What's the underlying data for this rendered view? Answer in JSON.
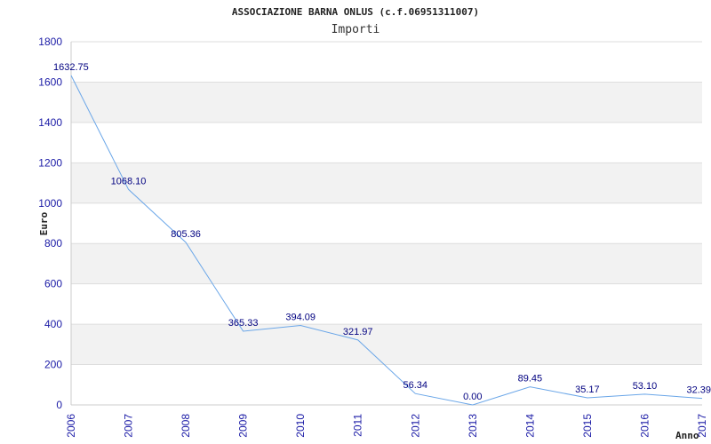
{
  "chart_data": {
    "type": "line",
    "title": "ASSOCIAZIONE BARNA ONLUS (c.f.06951311007)",
    "subtitle": "Importi",
    "xlabel": "Anno",
    "ylabel": "Euro",
    "ylim": [
      0,
      1800
    ],
    "yticks": [
      0,
      200,
      400,
      600,
      800,
      1000,
      1200,
      1400,
      1600,
      1800
    ],
    "categories": [
      "2006",
      "2007",
      "2008",
      "2009",
      "2010",
      "2011",
      "2012",
      "2013",
      "2014",
      "2015",
      "2016",
      "2017"
    ],
    "series": [
      {
        "values": [
          1632.75,
          1068.1,
          805.36,
          365.33,
          394.09,
          321.97,
          56.34,
          0.0,
          89.45,
          35.17,
          53.1,
          32.39
        ],
        "labels": [
          "1632.75",
          "1068.10",
          "805.36",
          "365.33",
          "394.09",
          "321.97",
          "56.34",
          "0.00",
          "89.45",
          "35.17",
          "53.10",
          "32.39"
        ],
        "color": "#6aa6e8"
      }
    ],
    "grid": true,
    "band_color": "#f2f2f2",
    "axis_text_color": "#1a1aa6",
    "label_color": "#000080"
  }
}
